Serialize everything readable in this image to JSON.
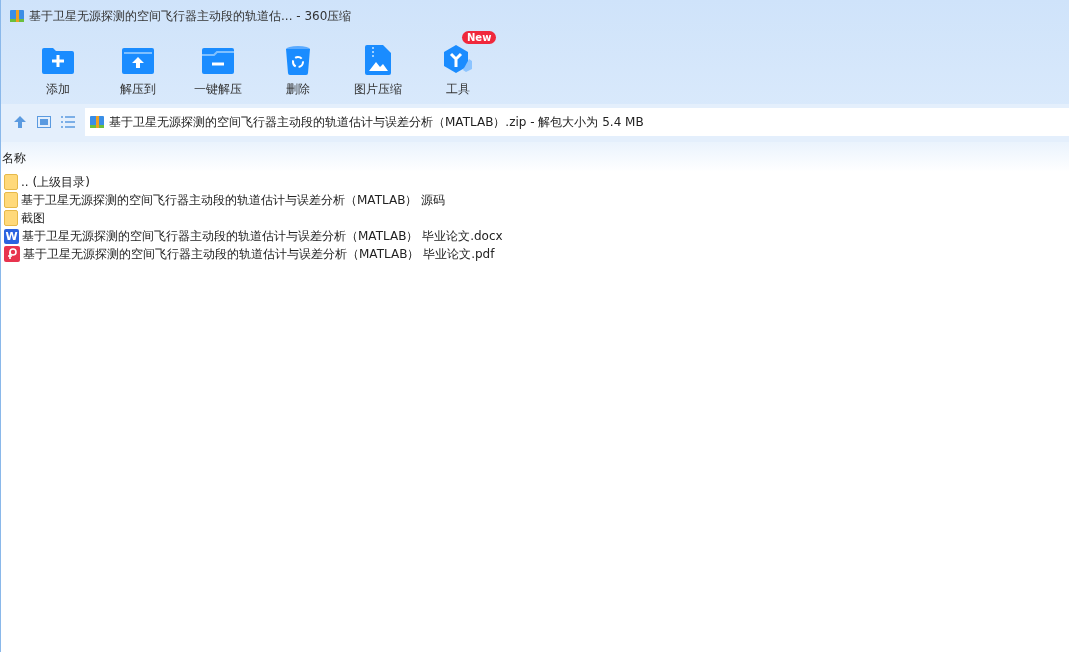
{
  "window": {
    "title": "基于卫星无源探测的空间飞行器主动段的轨道估... - 360压缩"
  },
  "toolbar": [
    {
      "label": "添加",
      "kind": "add"
    },
    {
      "label": "解压到",
      "kind": "extract"
    },
    {
      "label": "一键解压",
      "kind": "quick"
    },
    {
      "label": "删除",
      "kind": "delete"
    },
    {
      "label": "图片压缩",
      "kind": "image"
    },
    {
      "label": "工具",
      "kind": "tools",
      "badge": "New"
    }
  ],
  "address": {
    "path": "基于卫星无源探测的空间飞行器主动段的轨道估计与误差分析（MATLAB）.zip - 解包大小为 5.4 MB"
  },
  "table": {
    "columns": [
      "名称"
    ],
    "rows": [
      {
        "name": ".. (上级目录)",
        "kind": "folder"
      },
      {
        "name": "基于卫星无源探测的空间飞行器主动段的轨道估计与误差分析（MATLAB） 源码",
        "kind": "folder"
      },
      {
        "name": "截图",
        "kind": "folder"
      },
      {
        "name": "基于卫星无源探测的空间飞行器主动段的轨道估计与误差分析（MATLAB） 毕业论文.docx",
        "kind": "word",
        "glyph": "W"
      },
      {
        "name": "基于卫星无源探测的空间飞行器主动段的轨道估计与误差分析（MATLAB） 毕业论文.pdf",
        "kind": "pdf"
      }
    ]
  }
}
